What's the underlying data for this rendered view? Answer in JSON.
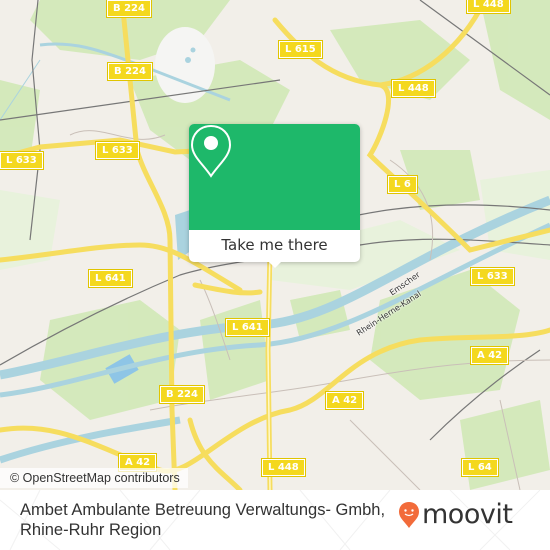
{
  "map": {
    "road_labels": [
      {
        "id": "b224-top",
        "text": "B 224"
      },
      {
        "id": "b224-mid",
        "text": "B 224"
      },
      {
        "id": "l615",
        "text": "L 615"
      },
      {
        "id": "l448-top",
        "text": "L 448"
      },
      {
        "id": "l448-corner",
        "text": "L 448"
      },
      {
        "id": "l633-left",
        "text": "L 633"
      },
      {
        "id": "l633-mid",
        "text": "L 633"
      },
      {
        "id": "l6-partial",
        "text": "L 6"
      },
      {
        "id": "l641-left",
        "text": "L 641"
      },
      {
        "id": "l641-mid",
        "text": "L 641"
      },
      {
        "id": "l633-right",
        "text": "L 633"
      },
      {
        "id": "a42-right",
        "text": "A 42"
      },
      {
        "id": "a42-mid",
        "text": "A 42"
      },
      {
        "id": "b224-bottom",
        "text": "B 224"
      },
      {
        "id": "a42-bottom",
        "text": "A 42"
      },
      {
        "id": "l448-bottom",
        "text": "L 448"
      },
      {
        "id": "l64-bottom",
        "text": "L 64"
      }
    ],
    "water_labels": [
      "Emscher",
      "Rhein-Herne-Kanal"
    ],
    "attribution": "© OpenStreetMap contributors"
  },
  "popup": {
    "icon": "location-pin-icon",
    "button_label": "Take me there",
    "color": "#1eb86a"
  },
  "footer": {
    "title": "Ambet Ambulante Betreuung Verwaltungs- Gmbh, Rhine-Ruhr Region",
    "logo_text": "moovit",
    "logo_color": "#f26b3a"
  }
}
